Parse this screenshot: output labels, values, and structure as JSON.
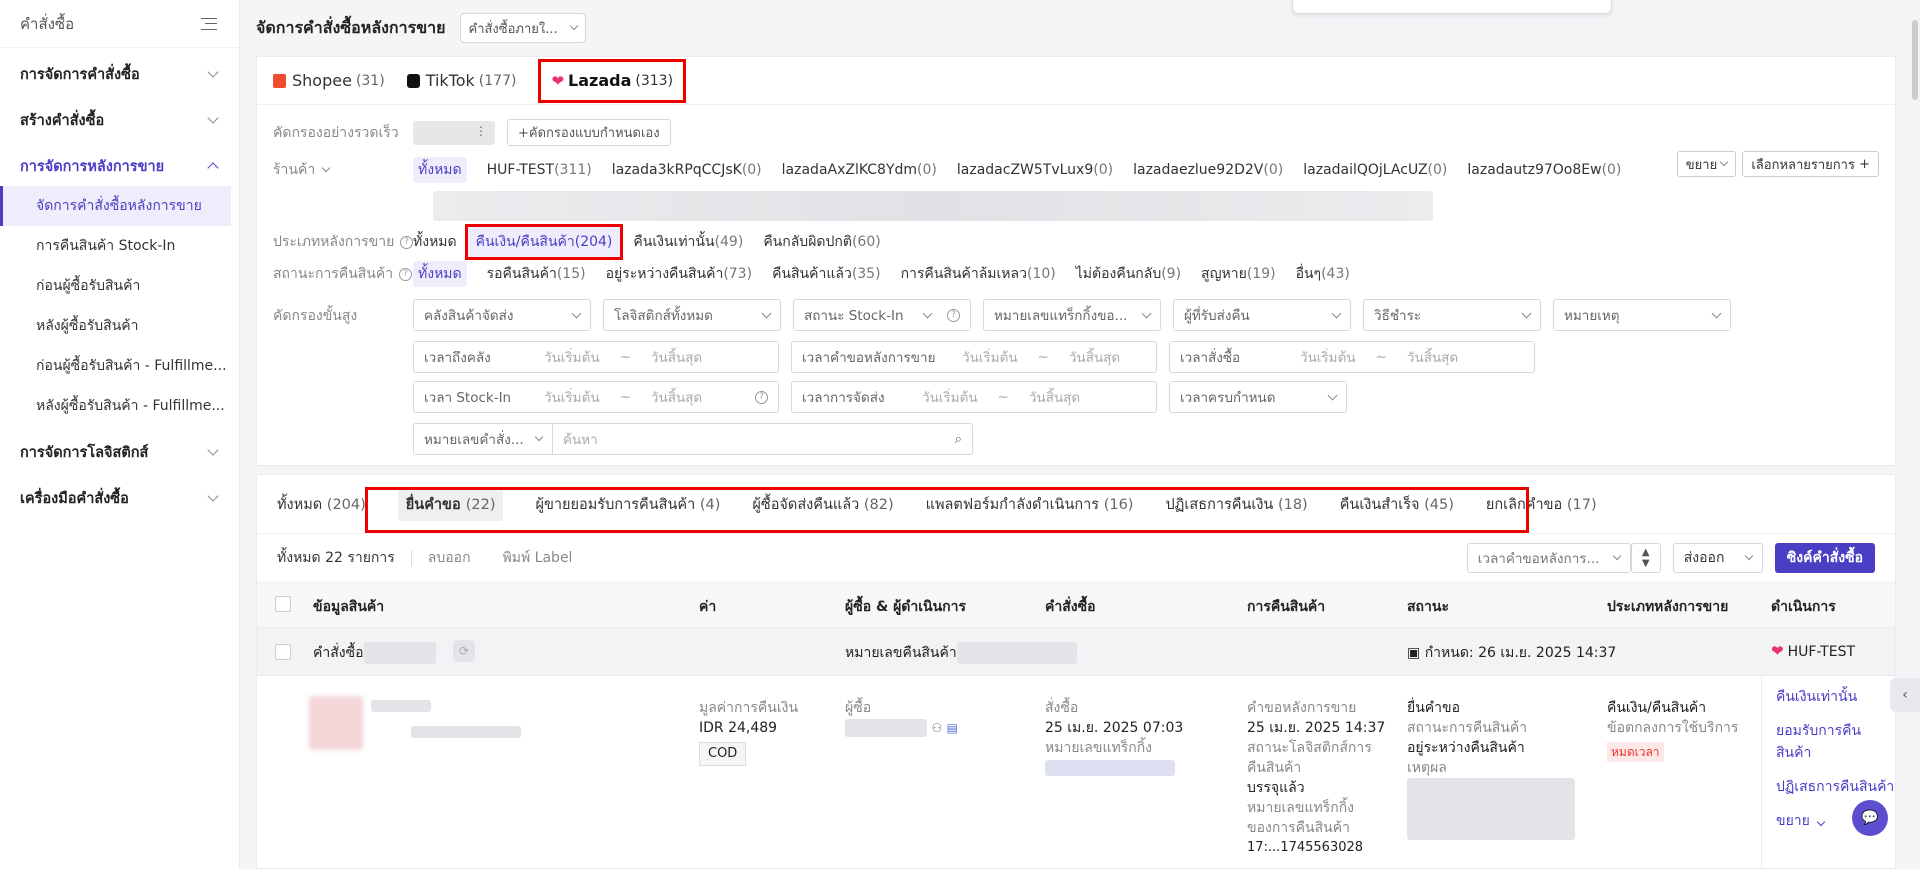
{
  "sidebar": {
    "title": "คำสั่งซื้อ",
    "groups": [
      {
        "label": "การจัดการคำสั่งซื้อ"
      },
      {
        "label": "สร้างคำสั่งซื้อ"
      },
      {
        "label": "การจัดการหลังการขาย"
      },
      {
        "label": "การจัดการโลจิสติกส์"
      },
      {
        "label": "เครื่องมือคำสั่งซื้อ"
      }
    ],
    "items": [
      {
        "label": "จัดการคำสั่งซื้อหลังการขาย"
      },
      {
        "label": "การคืนสินค้า Stock-In"
      },
      {
        "label": "ก่อนผู้ซื้อรับสินค้า"
      },
      {
        "label": "หลังผู้ซื้อรับสินค้า"
      },
      {
        "label": "ก่อนผู้ซื้อรับสินค้า - Fulfillme..."
      },
      {
        "label": "หลังผู้ซื้อรับสินค้า - Fulfillme..."
      }
    ]
  },
  "header": {
    "title": "จัดการคำสั่งซื้อหลังการขาย",
    "select": "คำสั่งซื้อภายใ..."
  },
  "platforms": [
    {
      "name": "Shopee",
      "count": "(31)"
    },
    {
      "name": "TikTok",
      "count": "(177)"
    },
    {
      "name": "Lazada",
      "count": "(313)"
    }
  ],
  "filters": {
    "quick_label": "คัดกรองอย่างรวดเร็ว",
    "custom_btn": "+คัดกรองแบบกำหนดเอง",
    "shop_label": "ร้านค้า",
    "shops": [
      {
        "name": "ทั้งหมด",
        "n": ""
      },
      {
        "name": "HUF-TEST",
        "n": "(311)"
      },
      {
        "name": "lazada3kRPqCCJsK",
        "n": "(0)"
      },
      {
        "name": "lazadaAxZlKC8Ydm",
        "n": "(0)"
      },
      {
        "name": "lazadacZW5TvLux9",
        "n": "(0)"
      },
      {
        "name": "lazadaezlue92D2V",
        "n": "(0)"
      },
      {
        "name": "lazadailQOjLAcUZ",
        "n": "(0)"
      },
      {
        "name": "lazadautz97Oo8Ew",
        "n": "(0)"
      }
    ],
    "expand_btn": "ขยาย",
    "multi_btn": "เลือกหลายรายการ",
    "type_label": "ประเภทหลังการขาย",
    "types": [
      {
        "name": "ทั้งหมด",
        "n": ""
      },
      {
        "name": "คืนเงิน/คืนสินค้า",
        "n": "(204)"
      },
      {
        "name": "คืนเงินเท่านั้น",
        "n": "(49)"
      },
      {
        "name": "คืนกลับผิดปกติ",
        "n": "(60)"
      }
    ],
    "status_label": "สถานะการคืนสินค้า",
    "statuses": [
      {
        "name": "ทั้งหมด",
        "n": ""
      },
      {
        "name": "รอคืนสินค้า",
        "n": "(15)"
      },
      {
        "name": "อยู่ระหว่างคืนสินค้า",
        "n": "(73)"
      },
      {
        "name": "คืนสินค้าแล้ว",
        "n": "(35)"
      },
      {
        "name": "การคืนสินค้าล้มเหลว",
        "n": "(10)"
      },
      {
        "name": "ไม่ต้องคืนกลับ",
        "n": "(9)"
      },
      {
        "name": "สูญหาย",
        "n": "(19)"
      },
      {
        "name": "อื่นๆ",
        "n": "(43)"
      }
    ],
    "advanced_label": "คัดกรองขั้นสูง",
    "adv_selects": [
      "คลังสินค้าจัดส่ง",
      "โลจิสติกส์ทั้งหมด",
      "สถานะ Stock-In",
      "หมายเลขแทร็กกิ้งขอ...",
      "ผู้ที่รับส่งคืน",
      "วิธีชำระ",
      "หมายเหตุ"
    ],
    "ranges": [
      {
        "label": "เวลาถึงคลัง",
        "start": "วันเริ่มต้น",
        "end": "วันสิ้นสุด"
      },
      {
        "label": "เวลาคำขอหลังการขาย",
        "start": "วันเริ่มต้น",
        "end": "วันสิ้นสุด"
      },
      {
        "label": "เวลาสั่งซื้อ",
        "start": "วันเริ่มต้น",
        "end": "วันสิ้นสุด"
      },
      {
        "label": "เวลา Stock-In",
        "start": "วันเริ่มต้น",
        "end": "วันสิ้นสุด"
      },
      {
        "label": "เวลาการจัดส่ง",
        "start": "วันเริ่มต้น",
        "end": "วันสิ้นสุด"
      }
    ],
    "range_sep": "~",
    "due_select": "เวลาครบกำหนด",
    "search_type": "หมายเลขคำสั่ง...",
    "search_ph": "ค้นหา"
  },
  "status_tabs": [
    {
      "name": "ทั้งหมด",
      "n": "(204)"
    },
    {
      "name": "ยื่นคำขอ",
      "n": "(22)"
    },
    {
      "name": "ผู้ขายยอมรับการคืนสินค้า",
      "n": "(4)"
    },
    {
      "name": "ผู้ซื้อจัดส่งคืนแล้ว",
      "n": "(82)"
    },
    {
      "name": "แพลตฟอร์มกำลังดำเนินการ",
      "n": "(16)"
    },
    {
      "name": "ปฏิเสธการคืนเงิน",
      "n": "(18)"
    },
    {
      "name": "คืนเงินสำเร็จ",
      "n": "(45)"
    },
    {
      "name": "ยกเลิกคำขอ",
      "n": "(17)"
    }
  ],
  "toolbar": {
    "total": "ทั้งหมด 22 รายการ",
    "delete": "ลบออก",
    "print": "พิมพ์ Label",
    "sort": "เวลาคำขอหลังการ...",
    "export": "ส่งออก",
    "sync": "ซิงค์คำสั่งซื้อ"
  },
  "table": {
    "headers": [
      "ข้อมูลสินค้า",
      "ค่า",
      "ผู้ซื้อ & ผู้ดำเนินการ",
      "คำสั่งซื้อ",
      "การคืนสินค้า",
      "สถานะ",
      "ประเภทหลังการขาย",
      "ดำเนินการ"
    ],
    "order_prefix": "คำสั่งซื้อ",
    "return_no_label": "หมายเลขคืนสินค้า",
    "due": "กำหนด:  26 เม.ย. 2025 14:37",
    "shop": "HUF-TEST",
    "row": {
      "refund_label": "มูลค่าการคืนเงิน",
      "refund_value": "IDR 24,489",
      "pay_tag": "COD",
      "buyer_label": "ผู้ซื้อ",
      "order_label": "สั่งซื้อ",
      "order_time": "25 เม.ย. 2025 07:03",
      "tracking_label": "หมายเลขแทร็กกิ้ง",
      "req_label": "คำขอหลังการขาย",
      "req_time": "25 เม.ย. 2025 14:37",
      "logistics_label": "สถานะโลจิสติกส์การ",
      "logistics_label2": "คืนสินค้า",
      "logistics_value": "บรรจุแล้ว",
      "ret_tracking_label": "หมายเลขแทร็กกิ้ง",
      "ret_tracking_label2": "ของการคืนสินค้า",
      "ret_tracking_value": "17:...1745563028",
      "status_main": "ยื่นคำขอ",
      "status_sub_label": "สถานะการคืนสินค้า",
      "status_sub_value": "อยู่ระหว่างคืนสินค้า",
      "reason_label": "เหตุผล",
      "type_main": "คืนเงิน/คืนสินค้า",
      "type_sub": "ข้อตกลงการใช้บริการ",
      "type_tag": "หมดเวลา",
      "actions": [
        "คืนเงินเท่านั้น",
        "ยอมรับการคืนสินค้า",
        "ปฏิเสธการคืนสินค้า",
        "ขยาย"
      ]
    }
  }
}
